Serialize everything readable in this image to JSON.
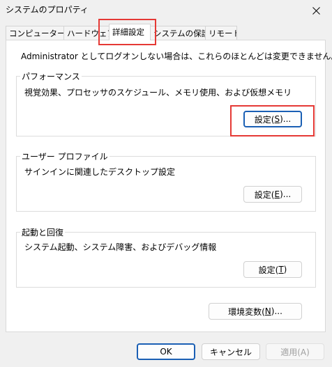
{
  "window": {
    "title": "システムのプロパティ"
  },
  "tabs": [
    {
      "label": "コンピューター名",
      "active": false
    },
    {
      "label": "ハードウェア",
      "active": false
    },
    {
      "label": "詳細設定",
      "active": true
    },
    {
      "label": "システムの保護",
      "active": false
    },
    {
      "label": "リモート",
      "active": false
    }
  ],
  "admin_note": "Administrator としてログオンしない場合は、これらのほとんどは変更できません。",
  "performance": {
    "title": "パフォーマンス",
    "description": "視覚効果、プロセッサのスケジュール、メモリ使用、および仮想メモリ",
    "button": {
      "pre": "設定(",
      "key": "S",
      "post": ")..."
    }
  },
  "user_profile": {
    "title": "ユーザー プロファイル",
    "description": "サインインに関連したデスクトップ設定",
    "button": {
      "pre": "設定(",
      "key": "E",
      "post": ")..."
    }
  },
  "startup_recovery": {
    "title": "起動と回復",
    "description": "システム起動、システム障害、およびデバッグ情報",
    "button": {
      "pre": "設定(",
      "key": "T",
      "post": ")"
    }
  },
  "env_vars_button": {
    "pre": "環境変数(",
    "key": "N",
    "post": ")..."
  },
  "footer": {
    "ok": "OK",
    "cancel": "キャンセル",
    "apply": "適用(A)"
  },
  "colors": {
    "highlight": "#e53935",
    "default_button_border": "#1a5fb4"
  }
}
